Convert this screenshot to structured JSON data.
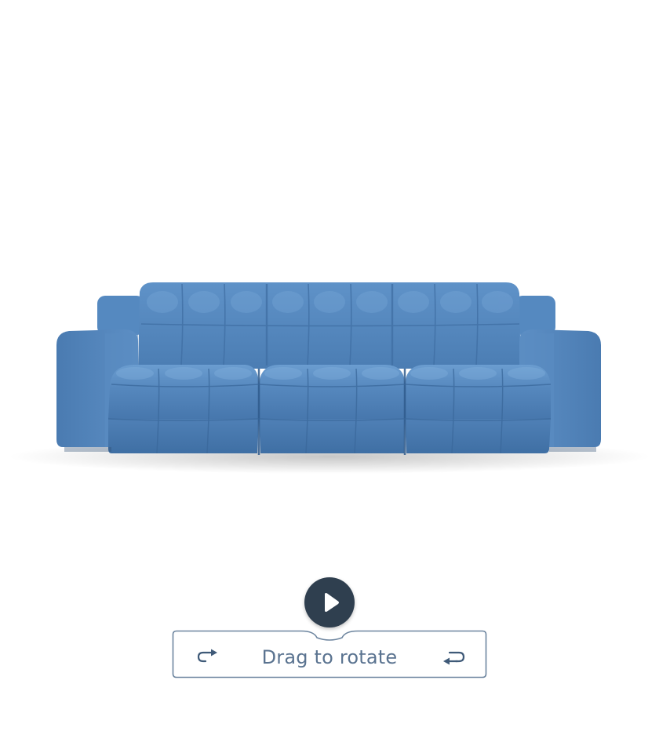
{
  "viewer": {
    "play_label": "",
    "rotate_hint": "Drag to rotate",
    "icons": {
      "play": "play-icon",
      "rotate_left": "rotate-arrow-left-icon",
      "rotate_right": "rotate-arrow-right-icon"
    }
  },
  "colors": {
    "sofa_base": "#4d7fb6",
    "sofa_light": "#6d9dcf",
    "sofa_dark": "#3a6699",
    "play_bg": "#2f3f4f",
    "hint_border": "#6d859f",
    "hint_text": "#5a7390"
  }
}
